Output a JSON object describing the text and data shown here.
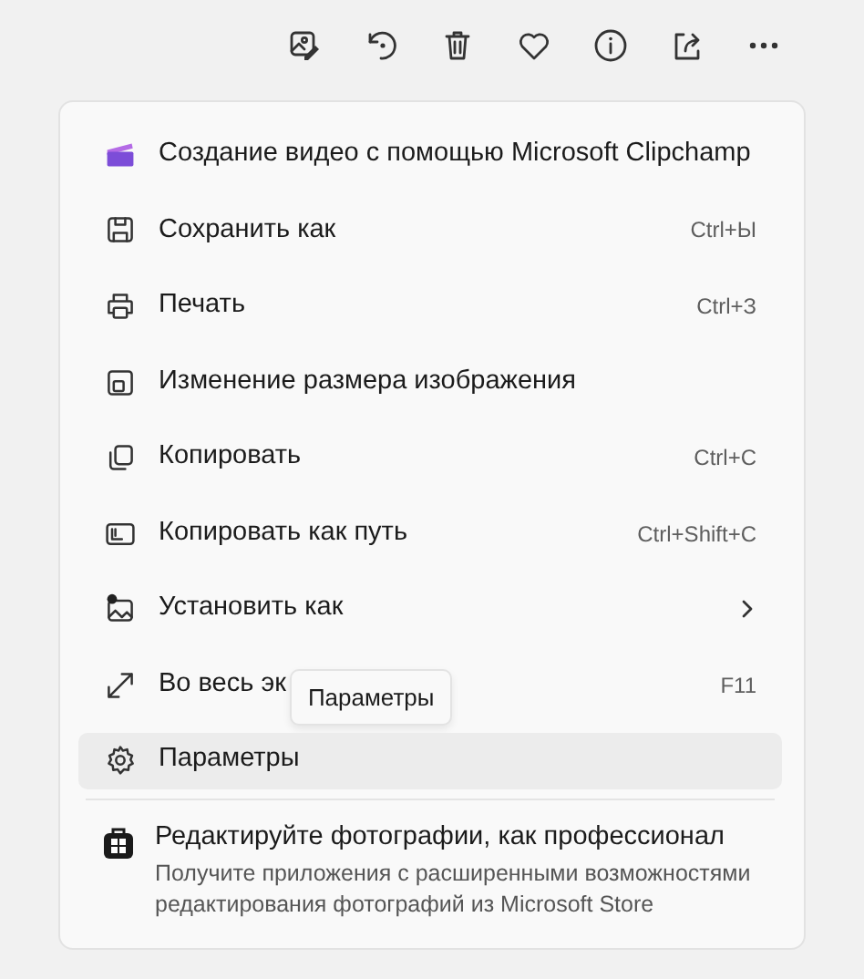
{
  "toolbar": {
    "buttons": [
      {
        "kind": "edit"
      },
      {
        "kind": "rotate"
      },
      {
        "kind": "delete"
      },
      {
        "kind": "favorite"
      },
      {
        "kind": "info"
      },
      {
        "kind": "share"
      },
      {
        "kind": "more"
      }
    ]
  },
  "menu": {
    "items": [
      {
        "kind": "clipchamp",
        "label": "Создание видео с помощью Microsoft Clipchamp",
        "selected": false
      },
      {
        "kind": "save",
        "label": "Сохранить как",
        "shortcut": "Ctrl+Ы",
        "selected": false
      },
      {
        "kind": "print",
        "label": "Печать",
        "shortcut": "Ctrl+З",
        "selected": false
      },
      {
        "kind": "resize",
        "label": "Изменение размера изображения",
        "selected": false
      },
      {
        "kind": "copy",
        "label": "Копировать",
        "shortcut": "Ctrl+C",
        "selected": false
      },
      {
        "kind": "copy-path",
        "label": "Копировать как путь",
        "shortcut": "Ctrl+Shift+C",
        "selected": false
      },
      {
        "kind": "set-as",
        "label": "Установить как",
        "submenu": true,
        "selected": false
      },
      {
        "kind": "fullscreen",
        "label": "Во весь эк",
        "shortcut": "F11",
        "tooltip": "Параметры",
        "selected": false
      },
      {
        "kind": "settings",
        "label": "Параметры",
        "selected": true
      }
    ],
    "promo": {
      "title": "Редактируйте фотографии, как профессионал",
      "text": "Получите приложения с расширенными возможностями редактирования фотографий из Microsoft Store"
    }
  }
}
